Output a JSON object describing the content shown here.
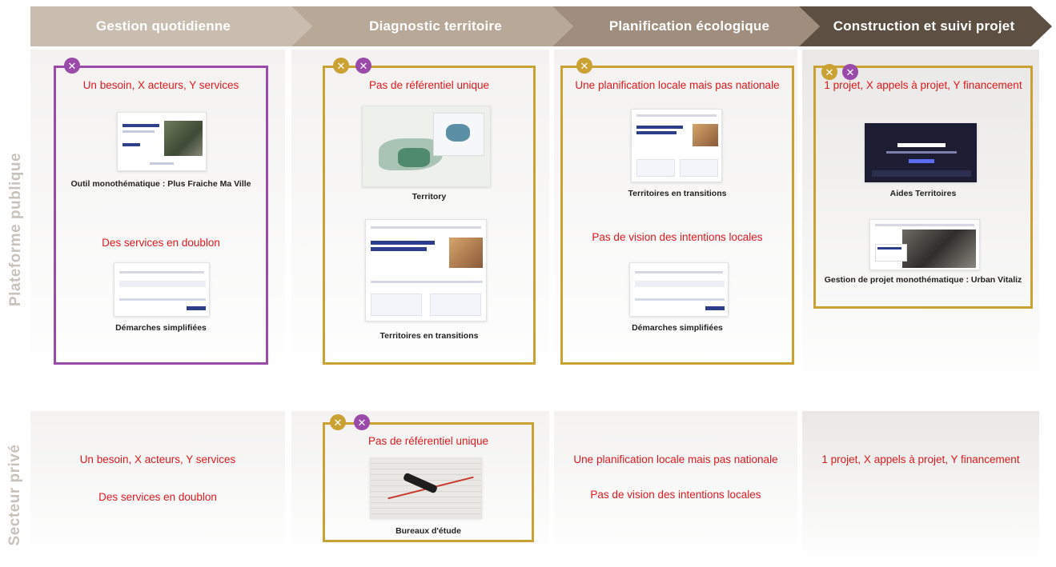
{
  "phases": [
    "Gestion quotidienne",
    "Diagnostic territoire",
    "Planification écologique",
    "Construction et suivi projet"
  ],
  "rows": [
    "Plateforme publique",
    "Secteur privé"
  ],
  "badge_glyph": "✕",
  "colors": {
    "purple": "#9a4aa8",
    "gold": "#c9a233",
    "issue_red": "#e0191d"
  },
  "public": {
    "gestion": {
      "issue1": "Un besoin, X acteurs, Y services",
      "tool1": "Outil monothématique : Plus Fraiche Ma Ville",
      "issue2": "Des services en doublon",
      "tool2": "Démarches simplifiées"
    },
    "diagnostic": {
      "issue1": "Pas de référentiel unique",
      "tool1": "Territory",
      "tool2": "Territoires en transitions"
    },
    "planification": {
      "issue1": "Une planification locale mais pas nationale",
      "tool1": "Territoires en transitions",
      "issue2": "Pas de vision des intentions locales",
      "tool2": "Démarches simplifiées"
    },
    "construction": {
      "issue1": "1 projet, X appels à projet, Y financement",
      "tool1": "Aides Territoires",
      "tool2": "Gestion de projet monothématique : Urban Vitaliz"
    }
  },
  "private": {
    "gestion": {
      "issue1": "Un besoin, X acteurs, Y services",
      "issue2": "Des services en doublon"
    },
    "diagnostic": {
      "issue1": "Pas de référentiel unique",
      "tool1": "Bureaux d'étude"
    },
    "planification": {
      "issue1": "Une planification locale mais pas nationale",
      "issue2": "Pas de vision des intentions locales"
    },
    "construction": {
      "issue1": "1 projet, X appels à projet, Y financement"
    }
  }
}
